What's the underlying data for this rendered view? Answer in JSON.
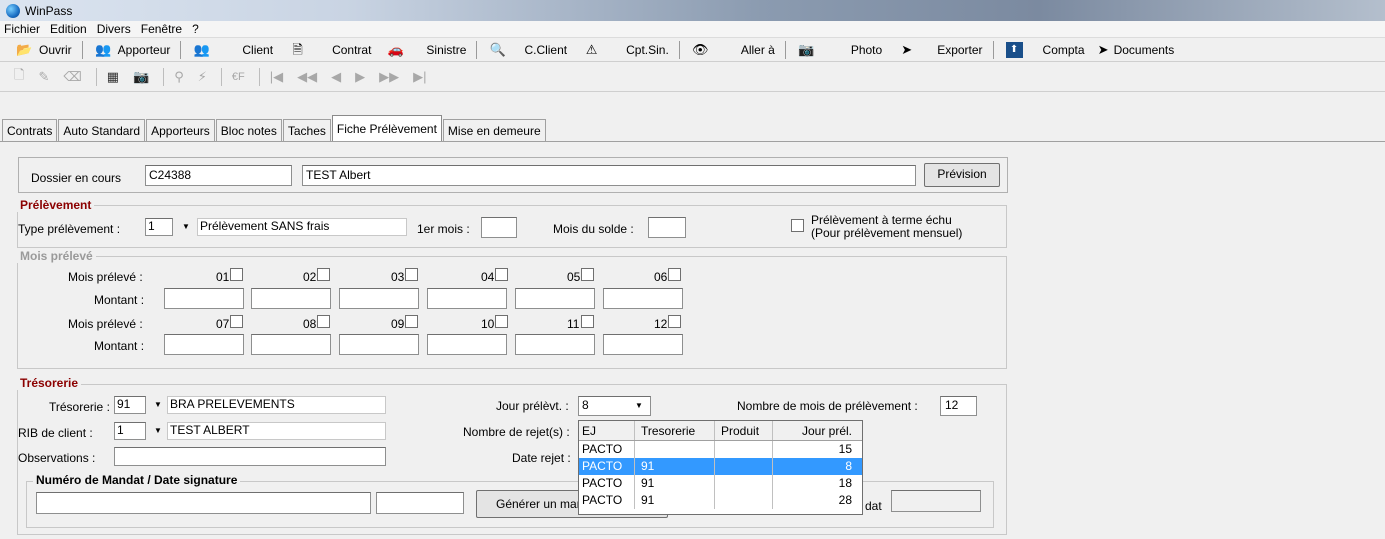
{
  "window": {
    "title": "WinPass"
  },
  "menu": [
    "Fichier",
    "Edition",
    "Divers",
    "Fenêtre",
    "?"
  ],
  "toolbar": [
    {
      "label": "Ouvrir",
      "icon": "folder-open-icon",
      "glyph": "📂"
    },
    {
      "label": "Apporteur",
      "icon": "apporteur-icon",
      "glyph": "👥"
    },
    {
      "label": "Client",
      "icon": "client-icon",
      "glyph": "👥"
    },
    {
      "label": "Contrat",
      "icon": "contrat-icon",
      "glyph": "🗎"
    },
    {
      "label": "Sinistre",
      "icon": "car-icon",
      "glyph": "🚗"
    },
    {
      "label": "C.Client",
      "icon": "magnifier-icon",
      "glyph": "🔍"
    },
    {
      "label": "Cpt.Sin.",
      "icon": "warning-sign-icon",
      "glyph": "⚠"
    },
    {
      "label": "Aller à",
      "icon": "eye-icon",
      "glyph": "👁"
    },
    {
      "label": "Photo",
      "icon": "camera-icon",
      "glyph": "📷"
    },
    {
      "label": "Exporter",
      "icon": "export-arrow-icon",
      "glyph": "➤"
    },
    {
      "label": "Compta",
      "icon": "compta-icon",
      "glyph": "⬛"
    },
    {
      "label": "Documents",
      "icon": "documents-arrow-icon",
      "glyph": "➤"
    }
  ],
  "toolbar2": [
    "🗋",
    "✎",
    "⌫",
    "▦",
    "📷",
    "⚲",
    "⚡",
    "€F",
    "|◀",
    "◀◀",
    "◀",
    "▶",
    "▶▶",
    "▶|"
  ],
  "tabs": [
    "Contrats",
    "Auto Standard",
    "Apporteurs",
    "Bloc notes",
    "Taches",
    "Fiche Prélèvement",
    "Mise en demeure"
  ],
  "dossier": {
    "label": "Dossier en cours",
    "code": "C24388",
    "name": "TEST Albert",
    "prevision_button": "Prévision"
  },
  "prelevement": {
    "legend": "Prélèvement",
    "type_label": "Type prélèvement :",
    "type_code": "1",
    "type_text": "Prélèvement SANS frais",
    "premier_mois_label": "1er mois :",
    "premier_mois_value": "",
    "mois_solde_label": "Mois du solde :",
    "mois_solde_value": "",
    "terme_echu_label_1": "Prélèvement à terme échu",
    "terme_echu_label_2": "(Pour prélèvement mensuel)"
  },
  "mois_preleve": {
    "legend": "Mois prélevé",
    "mois_label": "Mois prélevé :",
    "montant_label": "Montant :",
    "row1": [
      "01",
      "02",
      "03",
      "04",
      "05",
      "06"
    ],
    "row2": [
      "07",
      "08",
      "09",
      "10",
      "11",
      "12"
    ]
  },
  "tresorerie": {
    "legend": "Trésorerie",
    "tresorerie_label": "Trésorerie :",
    "tresorerie_code": "91",
    "tresorerie_text": "BRA  PRELEVEMENTS",
    "rib_label": "RIB de client :",
    "rib_code": "1",
    "rib_text": "TEST ALBERT",
    "observations_label": "Observations :",
    "observations_value": "",
    "jour_label": "Jour prélèvt. :",
    "jour_value": "8",
    "nb_rejet_label": "Nombre de rejet(s) :",
    "date_rejet_label": "Date rejet :",
    "nb_mois_label": "Nombre de mois de prélèvement :",
    "nb_mois_value": "12"
  },
  "mandat": {
    "legend": "Numéro de Mandat / Date signature",
    "numero": "",
    "date": "",
    "generate_button": "Générer un mandat",
    "date_mandat_suffix": "dat"
  },
  "popup": {
    "headers": [
      "EJ",
      "Tresorerie",
      "Produit",
      "Jour prél."
    ],
    "rows": [
      {
        "ej": "PACTO",
        "tresorerie": "",
        "produit": "",
        "jour": "15",
        "selected": false
      },
      {
        "ej": "PACTO",
        "tresorerie": "91",
        "produit": "",
        "jour": "8",
        "selected": true
      },
      {
        "ej": "PACTO",
        "tresorerie": "91",
        "produit": "",
        "jour": "18",
        "selected": false
      },
      {
        "ej": "PACTO",
        "tresorerie": "91",
        "produit": "",
        "jour": "28",
        "selected": false
      }
    ]
  }
}
